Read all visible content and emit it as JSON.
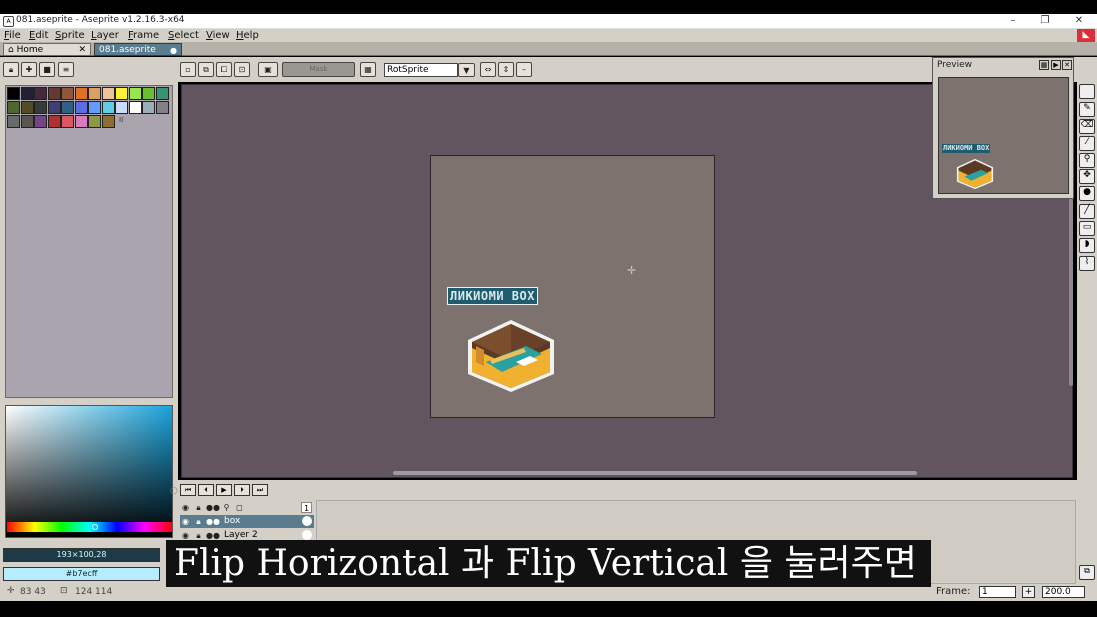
{
  "window": {
    "title": "081.aseprite - Aseprite v1.2.16.3-x64",
    "minimize": "–",
    "maximize": "❐",
    "close": "✕"
  },
  "menu": [
    "File",
    "Edit",
    "Sprite",
    "Layer",
    "Frame",
    "Select",
    "View",
    "Help"
  ],
  "tabs": [
    {
      "label": "Home",
      "close": "✕"
    },
    {
      "label": "081.aseprite"
    }
  ],
  "toolbar": {
    "mask_label": "Mask",
    "rotation_algorithm": "RotSprite"
  },
  "palette": {
    "colors": [
      "#000000",
      "#222034",
      "#45283c",
      "#663931",
      "#8f563b",
      "#df7126",
      "#d9a066",
      "#eec39a",
      "#fbf236",
      "#99e550",
      "#6abe30",
      "#37946e",
      "#4b692f",
      "#524b24",
      "#323c39",
      "#3f3f74",
      "#306082",
      "#5b6ee1",
      "#639bff",
      "#5fcde4",
      "#cbdbfc",
      "#ffffff",
      "#9badb7",
      "#847e87",
      "#696a6a",
      "#595652",
      "#76428a",
      "#ac3232",
      "#d95763",
      "#d77bba",
      "#8f974a",
      "#8a6f30"
    ],
    "extra_mark": "II"
  },
  "color_bar": {
    "selection_info": "193×100,28",
    "foreground_hex": "#b7ecff",
    "foreground_color": "#b7ecff",
    "sel_color": "#1e3a48"
  },
  "status": {
    "cursor": "83 43",
    "selection_size": "124 114"
  },
  "canvas": {
    "sprite_text": "ЛИКИОМИ BOX"
  },
  "preview": {
    "title": "Preview",
    "sprite_text": "ЛИКИОМИ BOX"
  },
  "layers": [
    {
      "name": "",
      "frame_num": "1"
    },
    {
      "name": "box"
    },
    {
      "name": "Layer 2"
    }
  ],
  "frame": {
    "label": "Frame:",
    "value": "1",
    "zoom": "200.0"
  },
  "subtitle": "Flip Horizontal 과 Flip Vertical 을 눌러주면"
}
